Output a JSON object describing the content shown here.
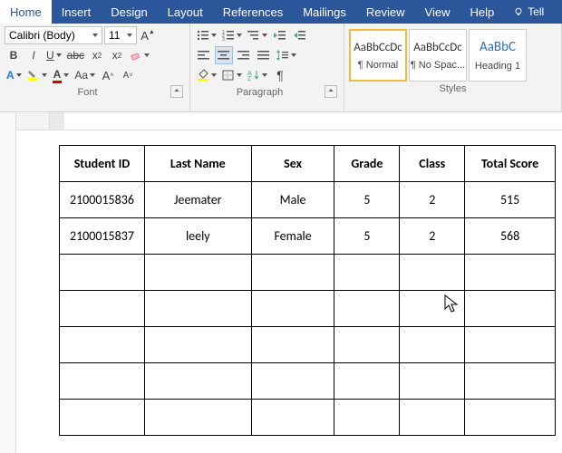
{
  "tabs": {
    "home": "Home",
    "insert": "Insert",
    "design": "Design",
    "layout": "Layout",
    "references": "References",
    "mailings": "Mailings",
    "review": "Review",
    "view": "View",
    "help": "Help",
    "tell": "Tell"
  },
  "font": {
    "name": "Calibri (Body)",
    "size": "11",
    "group_label": "Font"
  },
  "paragraph": {
    "group_label": "Paragraph"
  },
  "styles": {
    "group_label": "Styles",
    "sample": "AaBbCcDc",
    "sample_heading": "AaBbC",
    "normal": "¶ Normal",
    "nospacing": "¶ No Spac...",
    "heading1": "Heading 1"
  },
  "table": {
    "headers": [
      "Student ID",
      "Last Name",
      "Sex",
      "Grade",
      "Class",
      "Total Score"
    ],
    "rows": [
      [
        "2100015836",
        "Jeemater",
        "Male",
        "5",
        "2",
        "515"
      ],
      [
        "2100015837",
        "leely",
        "Female",
        "5",
        "2",
        "568"
      ],
      [
        "",
        "",
        "",
        "",
        "",
        ""
      ],
      [
        "",
        "",
        "",
        "",
        "",
        ""
      ],
      [
        "",
        "",
        "",
        "",
        "",
        ""
      ],
      [
        "",
        "",
        "",
        "",
        "",
        ""
      ],
      [
        "",
        "",
        "",
        "",
        "",
        ""
      ]
    ]
  }
}
